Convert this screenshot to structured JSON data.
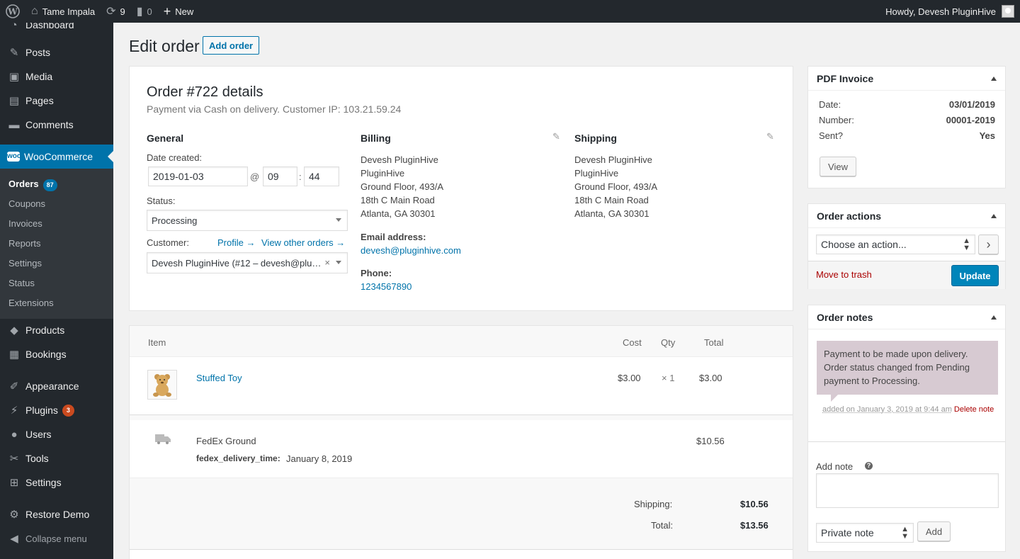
{
  "adminbar": {
    "site_name": "Tame Impala",
    "updates_count": "9",
    "comments_count": "0",
    "new_label": "New",
    "howdy": "Howdy, Devesh PluginHive"
  },
  "sidebar": {
    "dashboard": "Dashboard",
    "posts": "Posts",
    "media": "Media",
    "pages": "Pages",
    "comments": "Comments",
    "woocommerce": "WooCommerce",
    "sub": {
      "orders": "Orders",
      "orders_count": "87",
      "coupons": "Coupons",
      "invoices": "Invoices",
      "reports": "Reports",
      "settings": "Settings",
      "status": "Status",
      "extensions": "Extensions"
    },
    "products": "Products",
    "bookings": "Bookings",
    "appearance": "Appearance",
    "plugins": "Plugins",
    "plugins_count": "3",
    "users": "Users",
    "tools": "Tools",
    "settings": "Settings",
    "restore_demo": "Restore Demo",
    "collapse": "Collapse menu"
  },
  "page": {
    "title": "Edit order",
    "add_order": "Add order"
  },
  "order": {
    "heading": "Order #722 details",
    "meta": "Payment via Cash on delivery. Customer IP: 103.21.59.24",
    "general": {
      "title": "General",
      "date_label": "Date created:",
      "date": "2019-01-03",
      "at": "@",
      "hour": "09",
      "colon": ":",
      "minute": "44",
      "status_label": "Status:",
      "status": "Processing",
      "customer_label": "Customer:",
      "profile_link": "Profile →",
      "view_orders_link": "View other orders →",
      "customer": "Devesh PluginHive (#12 – devesh@plu…",
      "clear": "×"
    },
    "billing": {
      "title": "Billing",
      "lines": [
        "Devesh PluginHive",
        "PluginHive",
        "Ground Floor, 493/A",
        "18th C Main Road",
        "Atlanta, GA 30301"
      ],
      "email_label": "Email address:",
      "email": "devesh@pluginhive.com",
      "phone_label": "Phone:",
      "phone": "1234567890"
    },
    "shipping": {
      "title": "Shipping",
      "lines": [
        "Devesh PluginHive",
        "PluginHive",
        "Ground Floor, 493/A",
        "18th C Main Road",
        "Atlanta, GA 30301"
      ]
    }
  },
  "items": {
    "headers": {
      "item": "Item",
      "cost": "Cost",
      "qty": "Qty",
      "total": "Total"
    },
    "rows": [
      {
        "name": "Stuffed Toy",
        "cost": "$3.00",
        "qty": "× 1",
        "total": "$3.00"
      }
    ],
    "shipping": {
      "method": "FedEx Ground",
      "meta_key": "fedex_delivery_time:",
      "meta_value": "January 8, 2019",
      "cost": "$10.56"
    },
    "totals": {
      "shipping_label": "Shipping:",
      "shipping": "$10.56",
      "total_label": "Total:",
      "total": "$13.56"
    }
  },
  "pdf_invoice": {
    "title": "PDF Invoice",
    "date_label": "Date:",
    "date": "03/01/2019",
    "number_label": "Number:",
    "number": "00001-2019",
    "sent_label": "Sent?",
    "sent": "Yes",
    "view": "View"
  },
  "order_actions": {
    "title": "Order actions",
    "choose": "Choose an action...",
    "go": "›",
    "trash": "Move to trash",
    "update": "Update"
  },
  "order_notes": {
    "title": "Order notes",
    "note_text": "Payment to be made upon delivery. Order status changed from Pending payment to Processing.",
    "note_meta": "added on January 3, 2019 at 9:44 am",
    "delete": "Delete note",
    "add_note_label": "Add note",
    "help": "?",
    "note_type": "Private note",
    "add": "Add"
  },
  "colors": {
    "admin_dark": "#23282d",
    "accent": "#0073aa",
    "primary_button": "#0085ba",
    "note_bg": "#d7cad2",
    "badge_red": "#ca4a1f"
  }
}
